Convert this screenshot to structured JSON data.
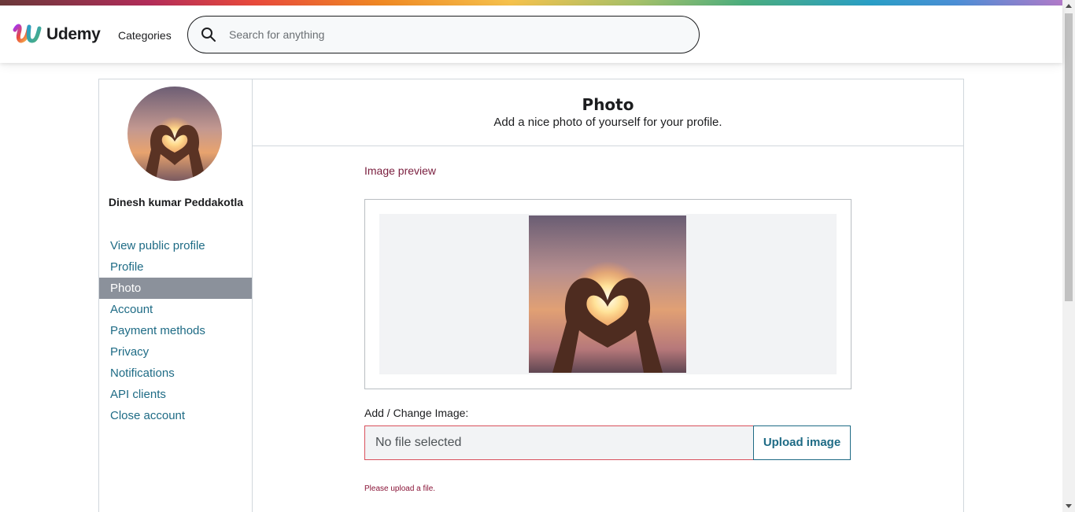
{
  "header": {
    "logo_text": "Udemy",
    "categories_label": "Categories",
    "search_placeholder": "Search for anything"
  },
  "sidebar": {
    "user_name": "Dinesh kumar Peddakotla",
    "items": [
      {
        "label": "View public profile",
        "active": false
      },
      {
        "label": "Profile",
        "active": false
      },
      {
        "label": "Photo",
        "active": true
      },
      {
        "label": "Account",
        "active": false
      },
      {
        "label": "Payment methods",
        "active": false
      },
      {
        "label": "Privacy",
        "active": false
      },
      {
        "label": "Notifications",
        "active": false
      },
      {
        "label": "API clients",
        "active": false
      },
      {
        "label": "Close account",
        "active": false
      }
    ]
  },
  "main": {
    "title": "Photo",
    "subtitle": "Add a nice photo of yourself for your profile.",
    "preview_label": "Image preview",
    "upload_label": "Add / Change Image:",
    "file_field_text": "No file selected",
    "upload_button_label": "Upload image",
    "error_text": "Please upload a file."
  },
  "colors": {
    "link": "#1e6b85",
    "active_nav_bg": "#8b919b",
    "error": "#8a1538",
    "preview_label": "#7a1e3e"
  },
  "icons": {
    "logo": "udemy-logo-icon",
    "search": "search-icon"
  }
}
